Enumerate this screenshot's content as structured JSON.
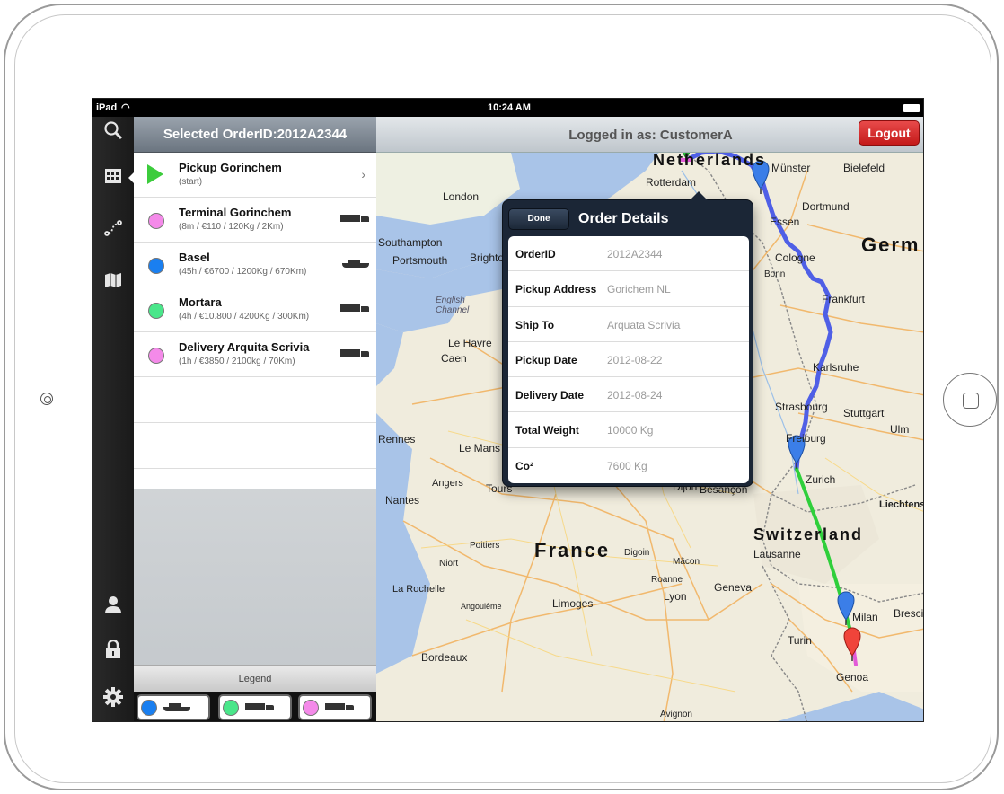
{
  "status": {
    "carrier": "iPad",
    "time": "10:24 AM"
  },
  "sidebar": {
    "header": "Selected OrderID:2012A2344"
  },
  "orders": [
    {
      "title": "Pickup Gorinchem",
      "subtitle": "(start)",
      "marker": "start",
      "color": "#3ccc3c",
      "vehicle": "",
      "chevron": "›"
    },
    {
      "title": "Terminal Gorinchem",
      "subtitle": "(8m / €110 / 120Kg / 2Km)",
      "marker": "dot",
      "color": "#f48ae9",
      "vehicle": "truck"
    },
    {
      "title": "Basel",
      "subtitle": "(45h / €6700 / 1200Kg / 670Km)",
      "marker": "dot",
      "color": "#1a7ff0",
      "vehicle": "ship"
    },
    {
      "title": "Mortara",
      "subtitle": "(4h / €10.800 / 4200Kg / 300Km)",
      "marker": "dot",
      "color": "#4ae68a",
      "vehicle": "truck"
    },
    {
      "title": "Delivery Arquita Scrivia",
      "subtitle": "(1h / €3850 / 2100kg / 70Km)",
      "marker": "dot",
      "color": "#f48ae9",
      "vehicle": "truck"
    }
  ],
  "legend": {
    "label": "Legend",
    "items": [
      {
        "color": "#1a7ff0",
        "vehicle": "ship"
      },
      {
        "color": "#4ae68a",
        "vehicle": "truck"
      },
      {
        "color": "#f48ae9",
        "vehicle": "truck"
      }
    ]
  },
  "map": {
    "header": "Logged in as: CustomerA",
    "logout": "Logout",
    "labels": {
      "netherlands": "Netherlands",
      "germany": "Germ",
      "france": "France",
      "switzerland": "Switzerland",
      "london": "London",
      "rotterdam": "Rotterdam",
      "essen": "Essen",
      "dortmund": "Dortmund",
      "bielefeld": "Bielefeld",
      "munster": "Münster",
      "cologne": "Cologne",
      "bonn": "Bonn",
      "frankfurt": "Frankfurt",
      "southampton": "Southampton",
      "portsmouth": "Portsmouth",
      "brighton": "Brighton",
      "english_channel": "English\nChannel",
      "le_havre": "Le Havre",
      "caen": "Caen",
      "rennes": "Rennes",
      "le_mans": "Le Mans",
      "nantes": "Nantes",
      "angers": "Angers",
      "tours": "Tours",
      "poitiers": "Poitiers",
      "niort": "Niort",
      "la_rochelle": "La Rochelle",
      "angouleme": "Angoulême",
      "limoges": "Limoges",
      "bordeaux": "Bordeaux",
      "dijon": "Dijon",
      "besancon": "Besançon",
      "digoin": "Digoin",
      "macon": "Mâcon",
      "roanne": "Roanne",
      "lyon": "Lyon",
      "geneva": "Geneva",
      "lausanne": "Lausanne",
      "zurich": "Zurich",
      "liechtenstein": "Liechtens",
      "karlsruhe": "Karlsruhe",
      "strasbourg": "Strasbourg",
      "stuttgart": "Stuttgart",
      "freiburg": "Freiburg",
      "ulm": "Ulm",
      "milan": "Milan",
      "brescia": "Bresci",
      "turin": "Turin",
      "genoa": "Genoa",
      "avignon": "Avignon"
    }
  },
  "details": {
    "title": "Order Details",
    "done": "Done",
    "rows": [
      {
        "key": "OrderID",
        "value": "2012A2344"
      },
      {
        "key": "Pickup Address",
        "value": "Gorichem NL"
      },
      {
        "key": "Ship To",
        "value": "Arquata Scrivia"
      },
      {
        "key": "Pickup Date",
        "value": "2012-08-22"
      },
      {
        "key": "Delivery Date",
        "value": "2012-08-24"
      },
      {
        "key": "Total Weight",
        "value": "10000 Kg"
      },
      {
        "key": "Co²",
        "value": "7600 Kg"
      }
    ]
  },
  "colors": {
    "route_ship": "#4f5fe6",
    "route_truck": "#2fcf3b",
    "marker_blue": "#3b7ee8",
    "marker_red": "#f0443a",
    "marker_green": "#2ecc40"
  }
}
